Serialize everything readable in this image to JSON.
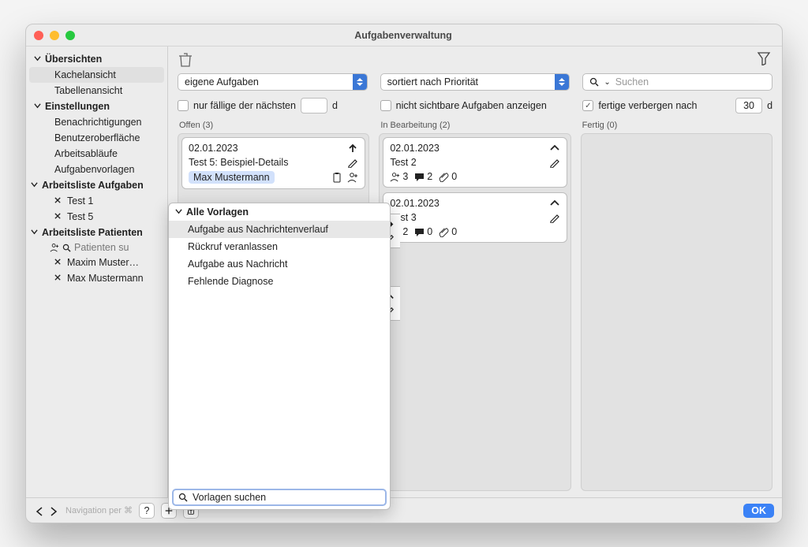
{
  "window": {
    "title": "Aufgabenverwaltung"
  },
  "sidebar": {
    "sect1": {
      "label": "Übersichten",
      "items": [
        "Kachelansicht",
        "Tabellenansicht"
      ],
      "selected": 0
    },
    "sect2": {
      "label": "Einstellungen",
      "items": [
        "Benachrichtigungen",
        "Benutzeroberfläche",
        "Arbeitsabläufe",
        "Aufgabenvorlagen"
      ]
    },
    "sect3": {
      "label": "Arbeitsliste Aufgaben",
      "items": [
        "Test 1",
        "Test 5"
      ]
    },
    "sect4": {
      "label": "Arbeitsliste Patienten",
      "search_placeholder": "Patienten su",
      "items": [
        "Maxim Muster…",
        "Max Mustermann"
      ]
    },
    "nav_hint": "Navigation per ⌘"
  },
  "filters": {
    "col1": {
      "select": "eigene Aufgaben",
      "chk_label": "nur fällige der nächsten",
      "chk_on": false,
      "num": "",
      "unit": "d"
    },
    "col2": {
      "select": "sortiert nach Priorität",
      "chk_label": "nicht sichtbare Aufgaben anzeigen",
      "chk_on": false
    },
    "col3": {
      "search_placeholder": "Suchen",
      "chk_label": "fertige verbergen nach",
      "chk_on": true,
      "num": "30",
      "unit": "d"
    }
  },
  "columns": {
    "offen": {
      "header": "Offen (3)"
    },
    "bearbeit": {
      "header": "In Bearbeitung (2)"
    },
    "fertig": {
      "header": "Fertig (0)"
    }
  },
  "cards": {
    "c1": {
      "date": "02.01.2023",
      "title": "Test 5: Beispiel-Details",
      "assignee": "Max Mustermann"
    },
    "c2": {
      "date": "02.01.2023",
      "title": "Test 2",
      "people": "3",
      "comments": "2",
      "attach": "0"
    },
    "c3": {
      "date": "02.01.2023",
      "title": "Test 3",
      "people": "2",
      "comments": "0",
      "attach": "0"
    }
  },
  "popup": {
    "header": "Alle Vorlagen",
    "items": [
      "Aufgabe aus Nachrichtenverlauf",
      "Rückruf veranlassen",
      "Aufgabe aus Nachricht",
      "Fehlende Diagnose"
    ],
    "selected": 0,
    "search_placeholder": "Vorlagen suchen"
  },
  "footer": {
    "ok": "OK"
  }
}
